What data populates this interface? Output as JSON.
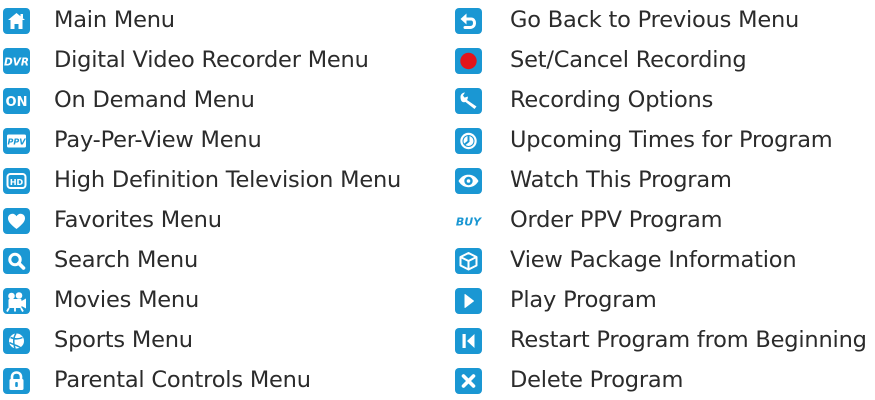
{
  "colors": {
    "icon_bg": "#1a97d3",
    "icon_fg": "#ffffff",
    "record_red": "#e3141b",
    "text": "#2b2b2b"
  },
  "menu_icons": [
    {
      "icon": "home-icon",
      "label": "Main Menu"
    },
    {
      "icon": "dvr-icon",
      "text": "DVR",
      "label": "Digital Video Recorder Menu"
    },
    {
      "icon": "on-demand-icon",
      "text": "ON",
      "label": "On Demand Menu"
    },
    {
      "icon": "ppv-icon",
      "text": "PPV",
      "label": "Pay-Per-View Menu"
    },
    {
      "icon": "hd-icon",
      "text": "HD",
      "label": "High Definition Television Menu"
    },
    {
      "icon": "heart-icon",
      "label": "Favorites Menu"
    },
    {
      "icon": "search-icon",
      "label": "Search Menu"
    },
    {
      "icon": "movie-camera-icon",
      "label": "Movies Menu"
    },
    {
      "icon": "sports-ball-icon",
      "label": "Sports Menu"
    },
    {
      "icon": "lock-icon",
      "label": "Parental Controls Menu"
    }
  ],
  "action_icons": [
    {
      "icon": "back-arrow-icon",
      "label": "Go Back to Previous Menu"
    },
    {
      "icon": "record-icon",
      "label": "Set/Cancel Recording"
    },
    {
      "icon": "wrench-icon",
      "label": "Recording Options"
    },
    {
      "icon": "clock-icon",
      "label": "Upcoming Times for Program"
    },
    {
      "icon": "eye-icon",
      "label": "Watch This Program"
    },
    {
      "icon": "buy-icon",
      "text": "BUY",
      "label": "Order PPV Program"
    },
    {
      "icon": "package-box-icon",
      "label": "View Package Information"
    },
    {
      "icon": "play-icon",
      "label": "Play Program"
    },
    {
      "icon": "restart-icon",
      "label": "Restart Program from Beginning"
    },
    {
      "icon": "delete-x-icon",
      "label": "Delete Program"
    }
  ]
}
